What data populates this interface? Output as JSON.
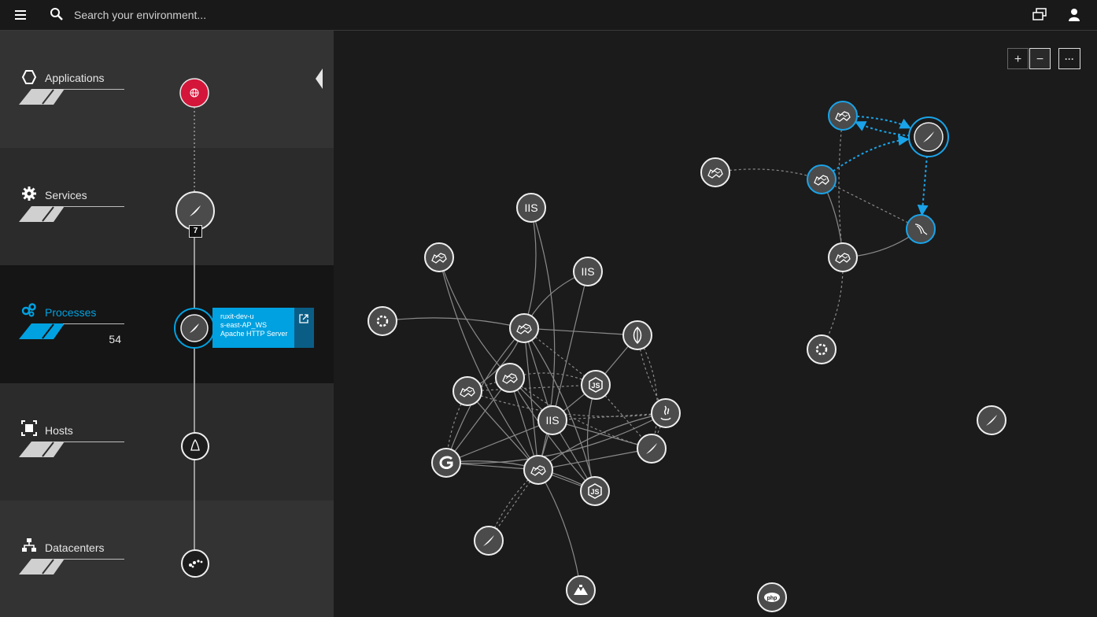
{
  "topbar": {
    "search_placeholder": "Search your environment..."
  },
  "tiers": [
    {
      "label": "Applications",
      "color": "#e6e6e6"
    },
    {
      "label": "Services",
      "color": "#e6e6e6"
    },
    {
      "label": "Processes",
      "color": "#00a1e0",
      "count": "54"
    },
    {
      "label": "Hosts",
      "color": "#e6e6e6"
    },
    {
      "label": "Datacenters",
      "color": "#e6e6e6"
    }
  ],
  "stack": {
    "services_badge": "7"
  },
  "tooltip": {
    "line1": "ruxit-dev-u",
    "line2": "s-east-AP_WS",
    "line3": "Apache HTTP Server"
  },
  "zoom": {
    "plus": "+",
    "minus": "−",
    "more": "···"
  },
  "graph_nodes": [
    {
      "icon": "tomcat-icon"
    },
    {
      "icon": "iis-icon",
      "text": "IIS"
    },
    {
      "icon": "dotnet-icon"
    },
    {
      "icon": "nodejs-icon"
    },
    {
      "icon": "java-icon"
    },
    {
      "icon": "apache-icon"
    },
    {
      "icon": "php-icon",
      "text": "php"
    },
    {
      "icon": "go-icon"
    },
    {
      "icon": "nginx-icon"
    },
    {
      "icon": "mongodb-icon"
    },
    {
      "icon": "mysql-icon"
    }
  ],
  "colors": {
    "accent": "#00a1e0",
    "app_node": "#d4163a",
    "background": "#1b1b1b"
  }
}
